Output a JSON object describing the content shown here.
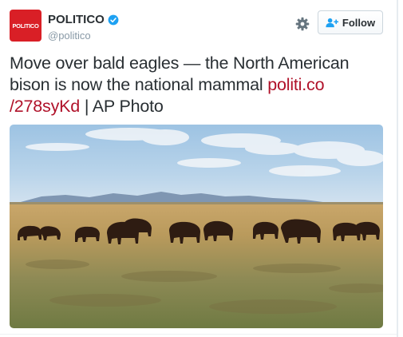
{
  "tweet": {
    "user": {
      "avatar_text": "POLITICO",
      "name": "POLITICO",
      "handle": "@politico",
      "verified": true
    },
    "actions": {
      "settings_icon": "gear-icon",
      "follow_icon": "add-user-icon",
      "follow_label": "Follow"
    },
    "text": {
      "before_link": "Move over bald eagles — the North American bison is now the national mammal ",
      "link_part1": "politi.co",
      "link_part2": "/278syKd",
      "after_link": " | AP Photo"
    },
    "photo": {
      "subject": "bison-herd-photo"
    }
  },
  "colors": {
    "brand_red": "#d91f26",
    "link_red": "#b0122a",
    "verified_blue": "#1da1f2",
    "text": "#292f33",
    "muted": "#8899a6"
  }
}
